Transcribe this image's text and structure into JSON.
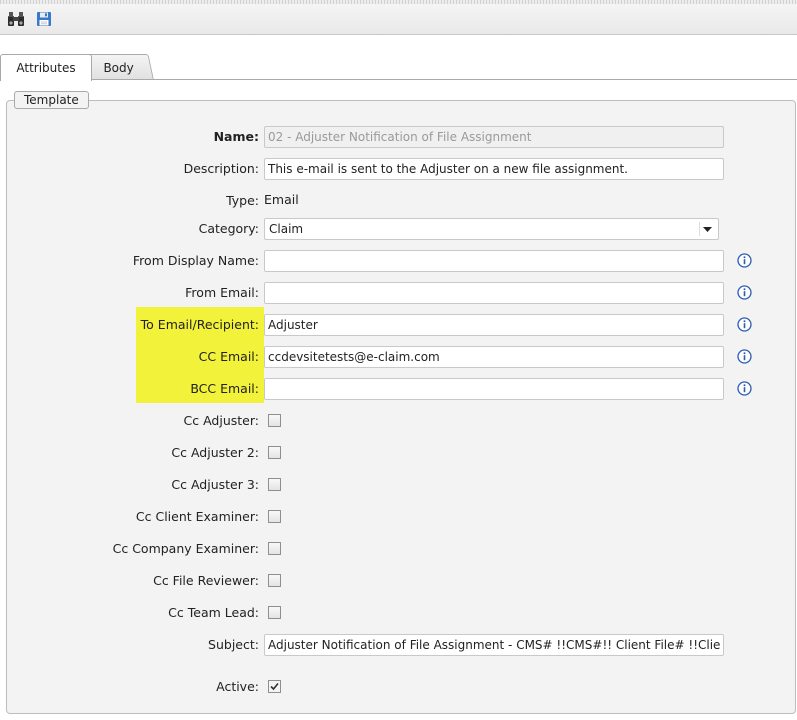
{
  "toolbar": {
    "buttons": [
      {
        "icon": "binoculars-icon"
      },
      {
        "icon": "save-disk-icon"
      }
    ]
  },
  "tabs": [
    {
      "label": "Attributes",
      "active": true
    },
    {
      "label": "Body",
      "active": false
    }
  ],
  "fieldset": {
    "legend": "Template"
  },
  "form": {
    "name": {
      "label": "Name:",
      "value": "02 - Adjuster Notification of File Assignment"
    },
    "description": {
      "label": "Description:",
      "value": "This e-mail is sent to the Adjuster on a new file assignment."
    },
    "type": {
      "label": "Type:",
      "value": "Email"
    },
    "category": {
      "label": "Category:",
      "value": "Claim"
    },
    "from_display_name": {
      "label": "From Display Name:",
      "value": ""
    },
    "from_email": {
      "label": "From Email:",
      "value": ""
    },
    "to_email": {
      "label": "To Email/Recipient:",
      "value": "Adjuster"
    },
    "cc_email": {
      "label": "CC Email:",
      "value": "ccdevsitetests@e-claim.com"
    },
    "bcc_email": {
      "label": "BCC Email:",
      "value": ""
    },
    "cc_adjuster": {
      "label": "Cc Adjuster:",
      "checked": false
    },
    "cc_adjuster_2": {
      "label": "Cc Adjuster 2:",
      "checked": false
    },
    "cc_adjuster_3": {
      "label": "Cc Adjuster 3:",
      "checked": false
    },
    "cc_client_examiner": {
      "label": "Cc Client Examiner:",
      "checked": false
    },
    "cc_company_examiner": {
      "label": "Cc Company Examiner:",
      "checked": false
    },
    "cc_file_reviewer": {
      "label": "Cc File Reviewer:",
      "checked": false
    },
    "cc_team_lead": {
      "label": "Cc Team Lead:",
      "checked": false
    },
    "subject": {
      "label": "Subject:",
      "value": "Adjuster Notification of File Assignment - CMS# !!CMS#!! Client File# !!Client#!!"
    },
    "active": {
      "label": "Active:",
      "checked": true
    }
  },
  "colors": {
    "highlight": "#f2f23a",
    "info_icon": "#2a5db0"
  }
}
